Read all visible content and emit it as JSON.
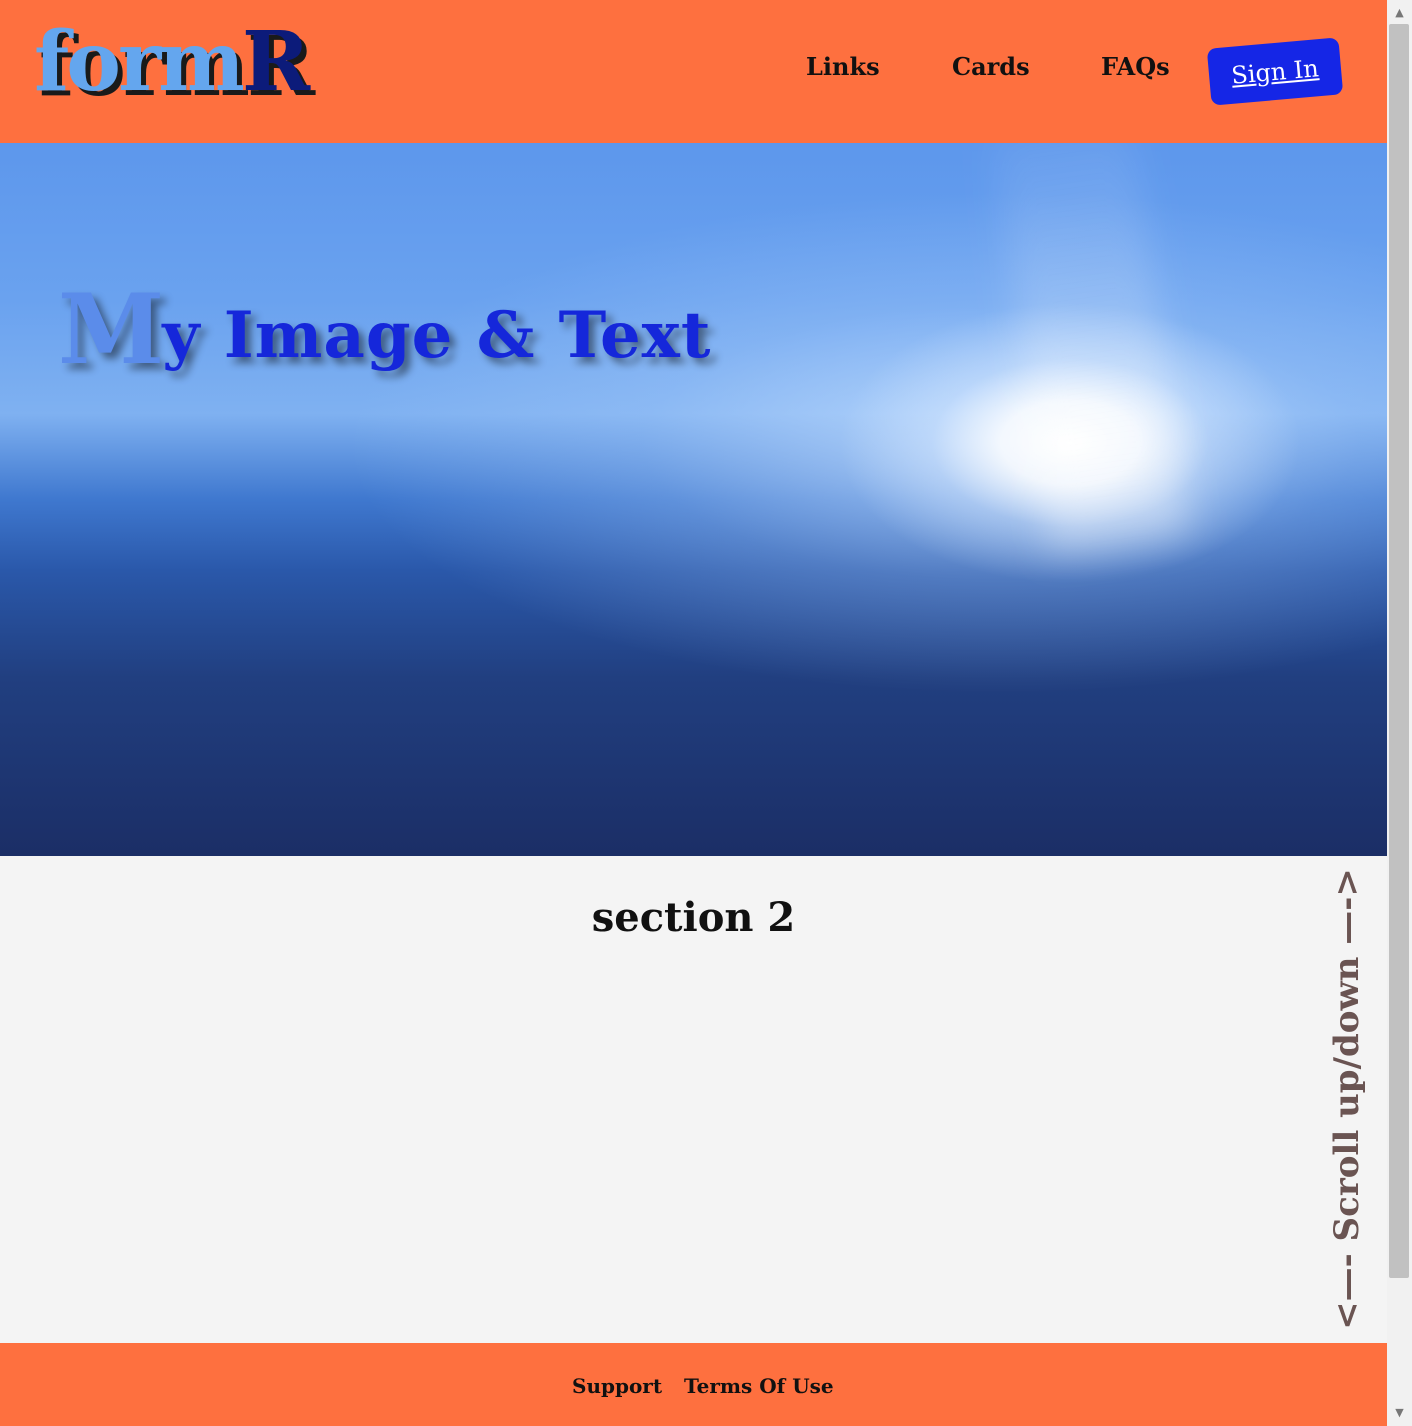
{
  "header": {
    "logo_part1": "form",
    "logo_part2": "R",
    "nav": [
      "Links",
      "Cards",
      "FAQs"
    ],
    "sign_in": "Sign In"
  },
  "hero": {
    "title_first": "M",
    "title_rest": "y Image & Text"
  },
  "section2": {
    "title": "section 2",
    "scroll_hint": "<—- Scroll up/down —->"
  },
  "footer": {
    "links": [
      "Support",
      "Terms Of Use"
    ]
  },
  "scrollbar": {
    "up_icon": "▲",
    "down_icon": "▼"
  },
  "colors": {
    "header_bg": "#fe703f",
    "sign_in_bg": "#1526e6",
    "logo_light": "#64a6ee",
    "logo_dark": "#0c1b7a",
    "hero_title": "#1527da",
    "scroll_hint": "#6a5452"
  }
}
